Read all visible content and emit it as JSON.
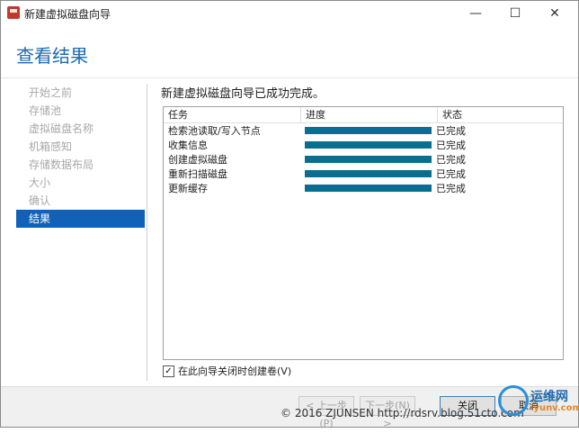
{
  "window": {
    "title": "新建虚拟磁盘向导",
    "min": "—",
    "max": "☐",
    "close": "✕"
  },
  "header": {
    "title": "查看结果"
  },
  "sidebar": {
    "items": [
      {
        "label": "开始之前",
        "active": false
      },
      {
        "label": "存储池",
        "active": false
      },
      {
        "label": "虚拟磁盘名称",
        "active": false
      },
      {
        "label": "机箱感知",
        "active": false
      },
      {
        "label": "存储数据布局",
        "active": false
      },
      {
        "label": "大小",
        "active": false
      },
      {
        "label": "确认",
        "active": false
      },
      {
        "label": "结果",
        "active": true
      }
    ]
  },
  "main": {
    "message": "新建虚拟磁盘向导已成功完成。",
    "table": {
      "headers": [
        "任务",
        "进度",
        "状态"
      ],
      "rows": [
        {
          "task": "检索池读取/写入节点",
          "progress": 1.0,
          "status": "已完成"
        },
        {
          "task": "收集信息",
          "progress": 1.0,
          "status": "已完成"
        },
        {
          "task": "创建虚拟磁盘",
          "progress": 1.0,
          "status": "已完成"
        },
        {
          "task": "重新扫描磁盘",
          "progress": 1.0,
          "status": "已完成"
        },
        {
          "task": "更新缓存",
          "progress": 1.0,
          "status": "已完成"
        }
      ]
    },
    "checkbox": {
      "label": "在此向导关闭时创建卷(V)",
      "checked": true
    }
  },
  "footer": {
    "prev": "< 上一步(P)",
    "next": "下一步(N) >",
    "close": "关闭",
    "cancel": "取消"
  },
  "watermark": "© 2016 ZJUNSEN http://rdsrv.blog.51cto.com",
  "logo": {
    "text": "运维网",
    "sub": "iyunv.com"
  },
  "colors": {
    "accent": "#1062b8",
    "bar": "#0a6e90",
    "title": "#1e6bb0"
  }
}
